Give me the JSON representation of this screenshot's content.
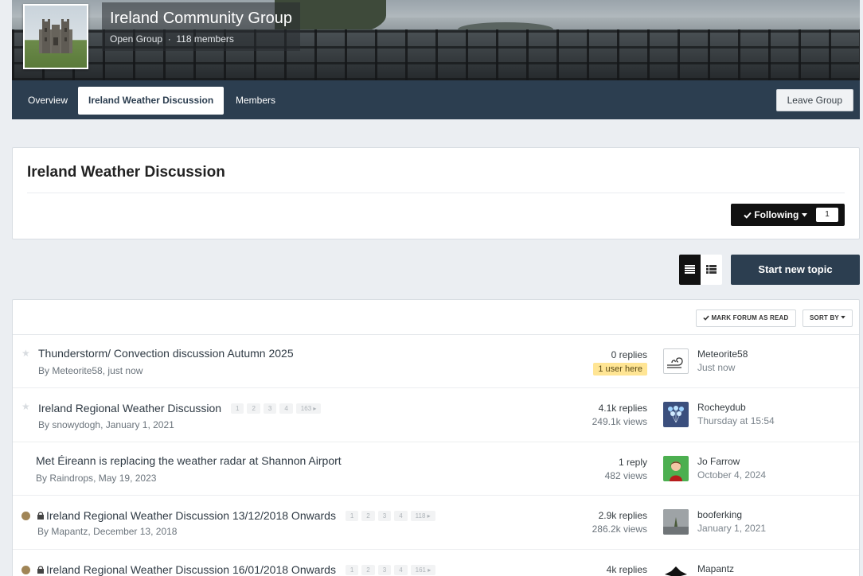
{
  "group": {
    "title": "Ireland Community Group",
    "type": "Open Group",
    "separator": "·",
    "members": "118 members",
    "tabs": [
      {
        "label": "Overview"
      },
      {
        "label": "Ireland Weather Discussion"
      },
      {
        "label": "Members"
      }
    ],
    "leave_label": "Leave Group"
  },
  "forum": {
    "title": "Ireland Weather Discussion",
    "following_label": "Following",
    "following_count": "1"
  },
  "toolbar": {
    "start_topic_label": "Start new topic",
    "mark_read_label": "MARK FORUM AS READ",
    "sort_label": "SORT BY"
  },
  "colors": {
    "header_bg": "#2c3e50",
    "page_bg": "#ebeef2",
    "unread_dot": "#a08556",
    "badge_bg": "#ffe594"
  },
  "topics": [
    {
      "title": "Thunderstorm/ Convection discussion Autumn 2025",
      "by": "By",
      "author": "Meteorite58",
      "date": "just now",
      "replies": "0 replies",
      "badge": "1 user here",
      "last_user": "Meteorite58",
      "last_time": "Just now",
      "pages": [],
      "icon": "star-icon"
    },
    {
      "title": "Ireland Regional Weather Discussion",
      "by": "By",
      "author": "snowydogh",
      "date": "January 1, 2021",
      "replies": "4.1k replies",
      "views": "249.1k views",
      "last_user": "Rocheydub",
      "last_time": "Thursday at 15:54",
      "pages": [
        "1",
        "2",
        "3",
        "4",
        "163"
      ],
      "icon": "star-icon"
    },
    {
      "title": "Met Éireann is replacing the weather radar at Shannon Airport",
      "by": "By",
      "author": "Raindrops",
      "date": "May 19, 2023",
      "replies": "1 reply",
      "views": "482 views",
      "last_user": "Jo Farrow",
      "last_time": "October 4, 2024",
      "pages": [],
      "icon": ""
    },
    {
      "title": "Ireland Regional Weather Discussion 13/12/2018 Onwards",
      "by": "By",
      "author": "Mapantz",
      "date": "December 13, 2018",
      "replies": "2.9k replies",
      "views": "286.2k views",
      "last_user": "booferking",
      "last_time": "January 1, 2021",
      "pages": [
        "1",
        "2",
        "3",
        "4",
        "118"
      ],
      "icon": "unread-dot-icon"
    },
    {
      "title": "Ireland Regional Weather Discussion 16/01/2018 Onwards",
      "by": "By",
      "author": "",
      "date": "",
      "replies": "4k replies",
      "views": "",
      "last_user": "Mapantz",
      "last_time": "",
      "pages": [
        "1",
        "2",
        "3",
        "4",
        "161"
      ],
      "icon": "unread-dot-icon"
    }
  ]
}
